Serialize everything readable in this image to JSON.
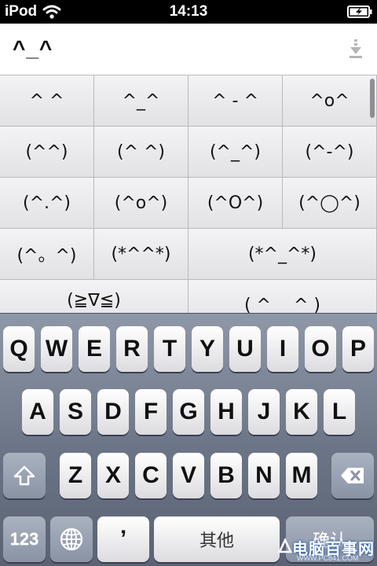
{
  "status_bar": {
    "carrier": "iPod",
    "time": "14:13",
    "icons": [
      "wifi-icon",
      "battery-charging-icon"
    ]
  },
  "input": {
    "text": "^_^",
    "icon": "download-arrow-icon"
  },
  "candidates": {
    "rows": [
      [
        "^ ^",
        "^_^",
        "^ - ^",
        "^o^"
      ],
      [
        "(^^)",
        "(^ ^)",
        "(^_^)",
        "(^-^)"
      ],
      [
        "(^.^)",
        "(^o^)",
        "(^O^)",
        "(^◯^)"
      ],
      [
        "(^。^)",
        "(*^^*)",
        "(*^_^*)"
      ],
      [
        "(≧∇≦)",
        "( ^　 ^ )"
      ]
    ]
  },
  "keyboard": {
    "row1": [
      "Q",
      "W",
      "E",
      "R",
      "T",
      "Y",
      "U",
      "I",
      "O",
      "P"
    ],
    "row2": [
      "A",
      "S",
      "D",
      "F",
      "G",
      "H",
      "J",
      "K",
      "L"
    ],
    "row3": [
      "Z",
      "X",
      "C",
      "V",
      "B",
      "N",
      "M"
    ],
    "numbers_label": "123",
    "apostrophe_label": "’",
    "space_label": "其他",
    "return_label": "确认",
    "icons": [
      "shift-icon",
      "backspace-icon",
      "globe-icon"
    ],
    "colors": {
      "key_light": "#ffffff",
      "key_dark": "#8a93a5",
      "keyboard_bg": "#6b7486"
    }
  },
  "watermark": {
    "text": "电脑百事网",
    "url": "WWW.PC841.COM"
  }
}
